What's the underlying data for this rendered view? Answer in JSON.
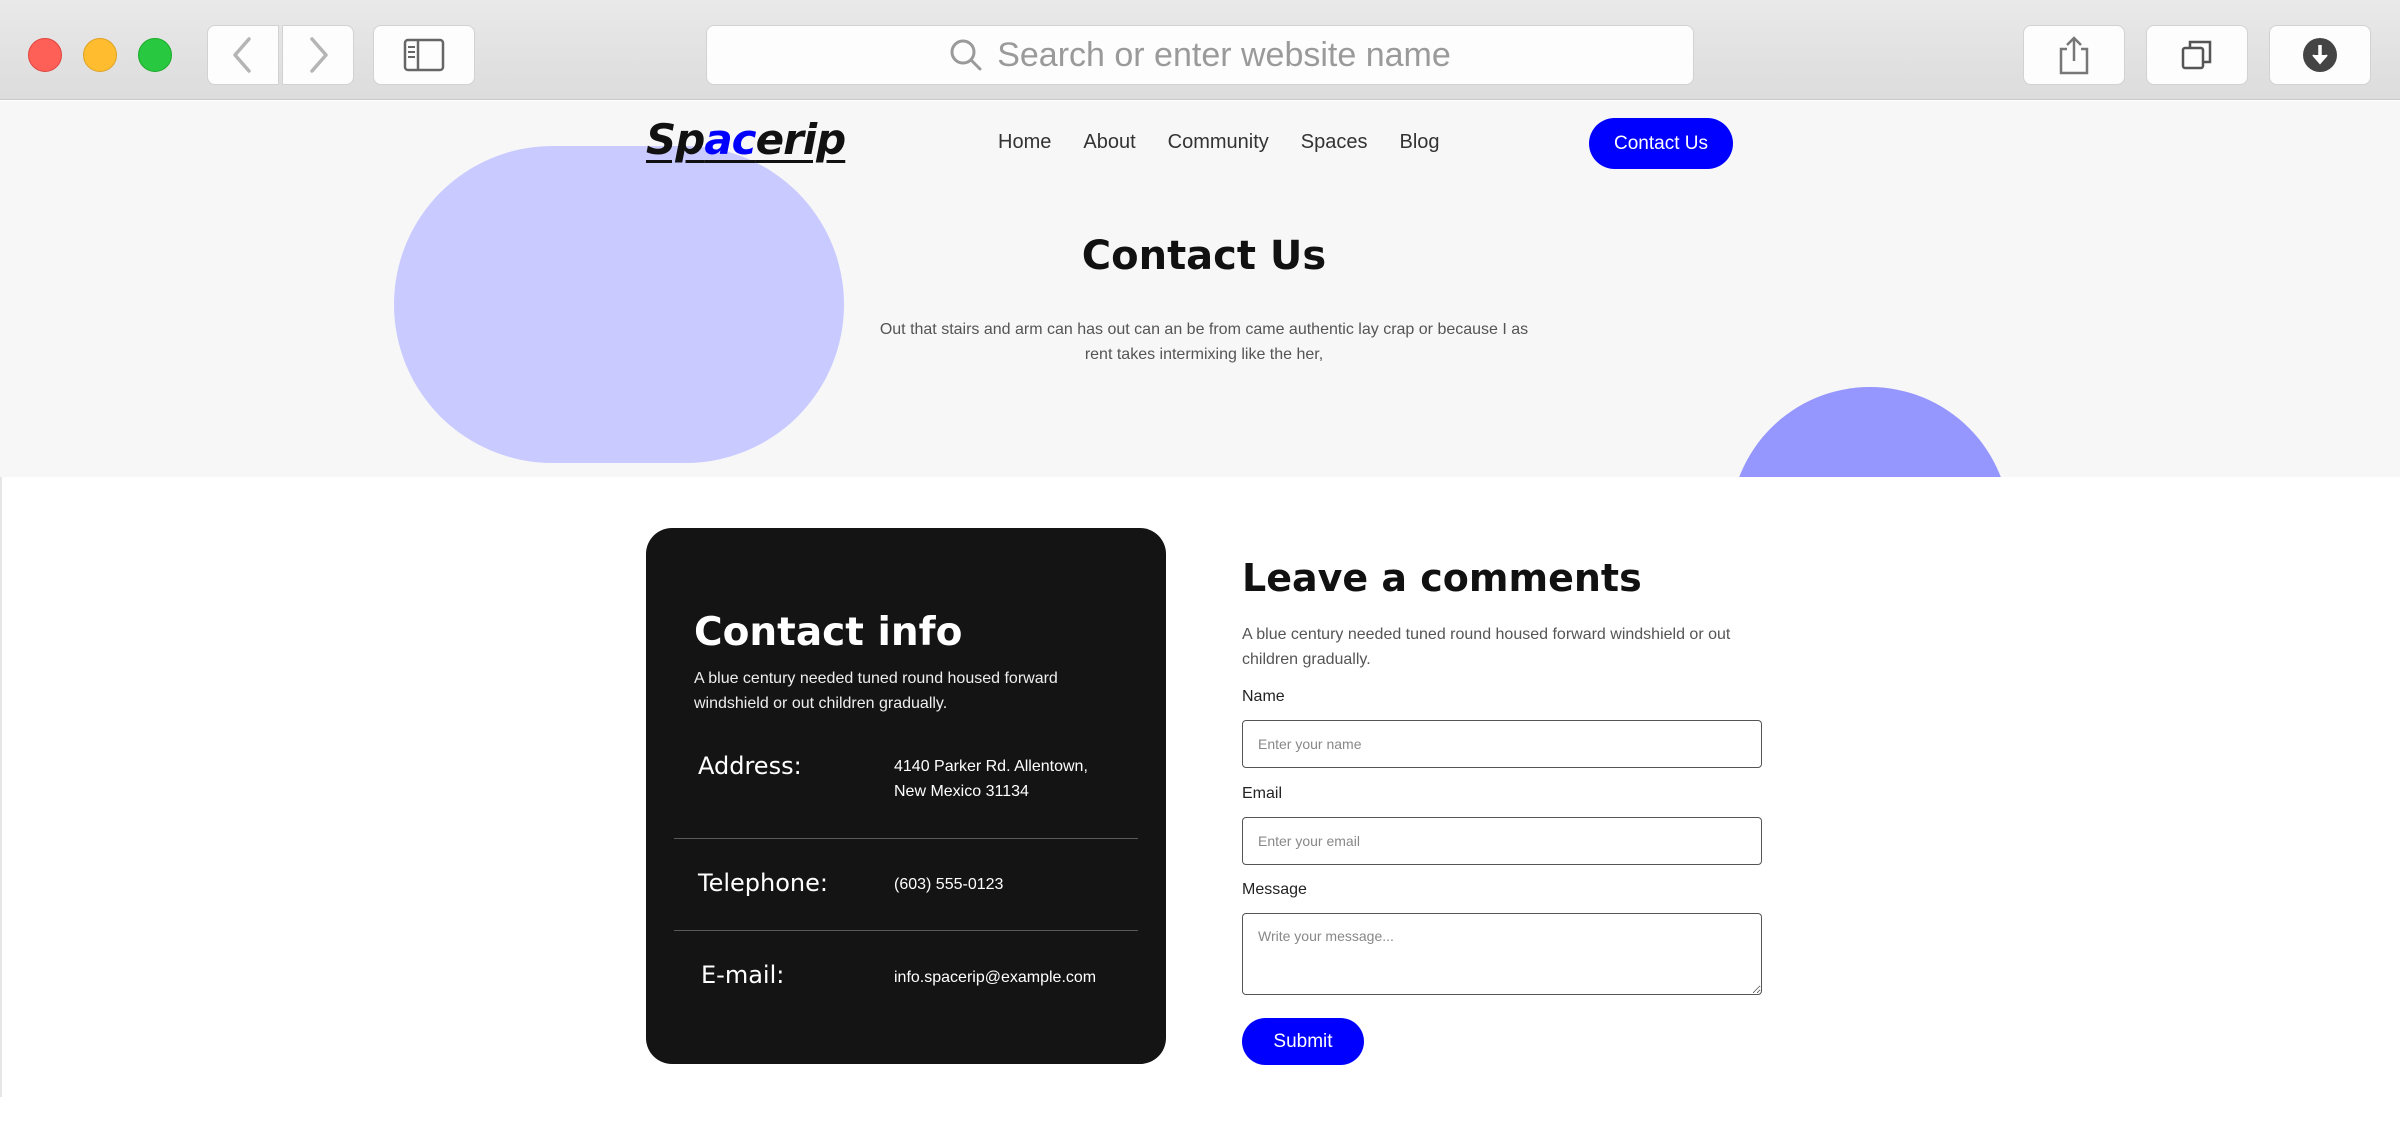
{
  "browser": {
    "url_placeholder": "Search or enter website name",
    "icons": [
      "back-chevron-icon",
      "forward-chevron-icon",
      "sidebar-icon",
      "search-icon",
      "share-icon",
      "tabs-icon",
      "download-icon"
    ]
  },
  "header": {
    "logo_prefix": "Sp",
    "logo_accent": "ac",
    "logo_suffix": "erip",
    "nav": [
      "Home",
      "About",
      "Community",
      "Spaces",
      "Blog"
    ],
    "cta_label": "Contact Us"
  },
  "hero": {
    "title": "Contact Us",
    "subtitle": "Out that stairs and arm can has out can an be from came authentic lay crap or because I as rent takes intermixing like the her,"
  },
  "contact_info": {
    "title": "Contact info",
    "description": "A blue century needed tuned round housed forward windshield or out children gradually.",
    "address_label": "Address:",
    "address_value": "4140 Parker Rd. Allentown, New Mexico 31134",
    "telephone_label": "Telephone:",
    "telephone_value": "(603) 555-0123",
    "email_label": "E-mail:",
    "email_value": "info.spacerip@example.com"
  },
  "comment_form": {
    "title": "Leave a comments",
    "description": "A blue century needed tuned round housed forward windshield or out children gradually.",
    "name_label": "Name",
    "name_placeholder": "Enter your name",
    "email_label": "Email",
    "email_placeholder": "Enter your email",
    "message_label": "Message",
    "message_placeholder": "Write your message...",
    "submit_label": "Submit"
  },
  "colors": {
    "accent": "#0000ff",
    "card_bg": "#141414",
    "blob_light": "#c9caff",
    "blob_dark": "#9597ff",
    "hero_bg": "#f7f7f7"
  }
}
